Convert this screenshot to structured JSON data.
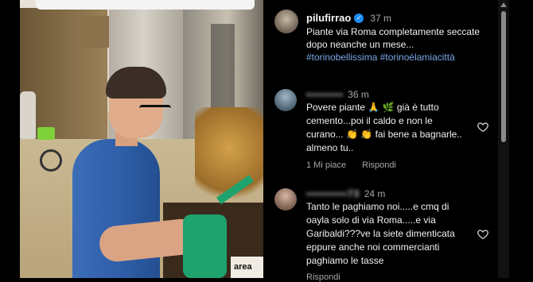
{
  "post": {
    "username": "pilufirrao",
    "time": "37 m",
    "caption": "Piante via Roma completamente seccate dopo neanche un mese...",
    "hashtags": "#torinobellissima #torinoèlamiacittà"
  },
  "comments": [
    {
      "username": "•••••••••",
      "time": "36 m",
      "text": "Povere piante 🙏 🌿 già è tutto cemento...poi il caldo e non le curano... 👏 👏 fai bene a bagnarle.. almeno tu..",
      "likes": "1 Mi piace",
      "reply": "Rispondi"
    },
    {
      "username": "••••••••••73",
      "time": "24 m",
      "text": "Tanto le paghiamo noi.....e cmq di oayla solo di via Roma.....e via Garibaldi???ve la siete dimenticata eppure anche noi commercianti paghiamo le tasse",
      "reply": "Rispondi"
    }
  ],
  "video": {
    "sign_text": "area"
  },
  "colors": {
    "hashtag": "#7aa7e6",
    "verified": "#1a8cf0",
    "background": "#000000"
  }
}
